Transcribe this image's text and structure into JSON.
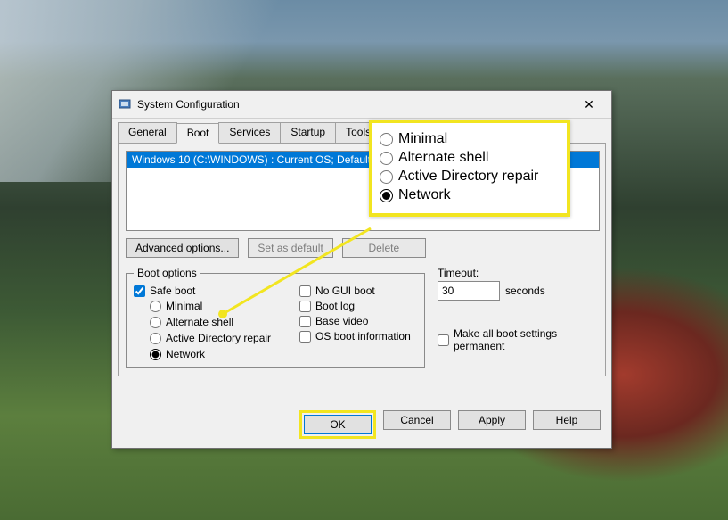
{
  "window": {
    "title": "System Configuration"
  },
  "tabs": {
    "general": "General",
    "boot": "Boot",
    "services": "Services",
    "startup": "Startup",
    "tools": "Tools"
  },
  "oslist": {
    "entry": "Windows 10 (C:\\WINDOWS) : Current OS; Default OS"
  },
  "buttons": {
    "advanced": "Advanced options...",
    "set_default": "Set as default",
    "delete": "Delete"
  },
  "boot_options": {
    "legend": "Boot options",
    "safe_boot": "Safe boot",
    "minimal": "Minimal",
    "alternate_shell": "Alternate shell",
    "ad_repair": "Active Directory repair",
    "network": "Network",
    "no_gui": "No GUI boot",
    "boot_log": "Boot log",
    "base_video": "Base video",
    "os_info": "OS boot information"
  },
  "timeout": {
    "label": "Timeout:",
    "value": "30",
    "unit": "seconds"
  },
  "permanent": "Make all boot settings permanent",
  "actions": {
    "ok": "OK",
    "cancel": "Cancel",
    "apply": "Apply",
    "help": "Help"
  },
  "callout": {
    "minimal": "Minimal",
    "alternate_shell": "Alternate shell",
    "ad_repair": "Active Directory repair",
    "network": "Network"
  }
}
